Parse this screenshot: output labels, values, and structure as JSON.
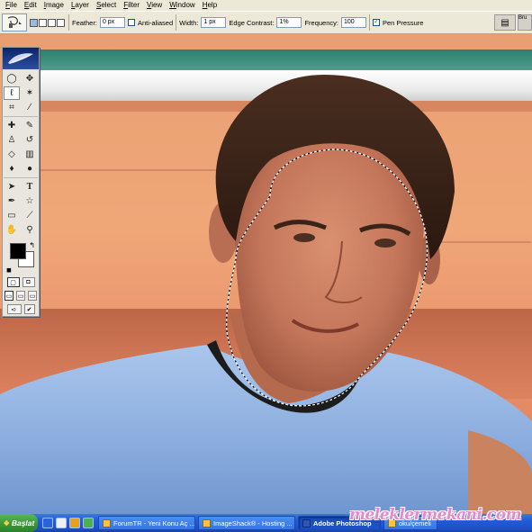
{
  "menu": {
    "items": [
      "File",
      "Edit",
      "Image",
      "Layer",
      "Select",
      "Filter",
      "View",
      "Window",
      "Help"
    ]
  },
  "options": {
    "feather_label": "Feather:",
    "feather_value": "0 px",
    "antialiased_label": "Anti-aliased",
    "antialiased_checked": false,
    "width_label": "Width:",
    "width_value": "1 px",
    "edge_contrast_label": "Edge Contrast:",
    "edge_contrast_value": "1%",
    "frequency_label": "Frequency:",
    "frequency_value": "100",
    "pen_pressure_label": "Pen Pressure",
    "pen_pressure_checked": true,
    "brushes_tab": "Bru"
  },
  "toolbox": {
    "tools": [
      {
        "left": "marquee-icon",
        "right": "move-icon"
      },
      {
        "left": "magnetic-lasso-icon",
        "right": "magic-wand-icon"
      },
      {
        "left": "crop-icon",
        "right": "slice-icon"
      },
      {
        "left": "healing-brush-icon",
        "right": "brush-icon"
      },
      {
        "left": "clone-stamp-icon",
        "right": "history-brush-icon"
      },
      {
        "left": "eraser-icon",
        "right": "gradient-icon"
      },
      {
        "left": "blur-icon",
        "right": "dodge-icon"
      },
      {
        "left": "path-selection-icon",
        "right": "type-icon"
      },
      {
        "left": "pen-icon",
        "right": "shape-icon"
      },
      {
        "left": "notes-icon",
        "right": "eyedropper-icon"
      },
      {
        "left": "hand-icon",
        "right": "zoom-icon"
      }
    ],
    "foreground_color": "#000000",
    "background_color": "#ffffff"
  },
  "taskbar": {
    "start_label": "Başlat",
    "tasks": [
      {
        "label": "ForumTR - Yeni Konu Aç ...",
        "active": false
      },
      {
        "label": "ImageShack® - Hosting ...",
        "active": false
      },
      {
        "label": "Adobe Photoshop",
        "active": true
      },
      {
        "label": "oku/çemeli",
        "active": false
      }
    ]
  },
  "watermark": "meleklermekani.com"
}
